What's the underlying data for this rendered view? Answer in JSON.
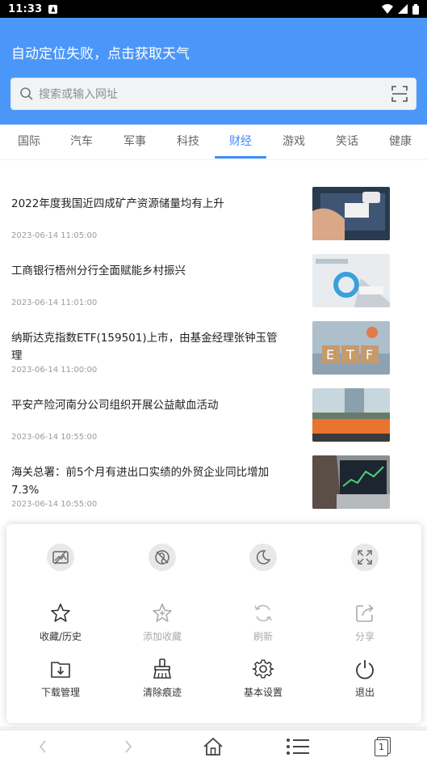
{
  "status_bar": {
    "time": "11:33"
  },
  "header": {
    "weather_text": "自动定位失败，点击获取天气",
    "search_placeholder": "搜索或输入网址",
    "accent": "#4b97f9"
  },
  "tabs": [
    {
      "label": "国际"
    },
    {
      "label": "汽车"
    },
    {
      "label": "军事"
    },
    {
      "label": "科技"
    },
    {
      "label": "财经",
      "active": true
    },
    {
      "label": "游戏"
    },
    {
      "label": "笑话"
    },
    {
      "label": "健康"
    }
  ],
  "news": [
    {
      "title": "2022年度我国近四成矿产资源储量均有上升",
      "time": "2023-06-14 11:05:00"
    },
    {
      "title": "工商银行梧州分行全面赋能乡村振兴",
      "time": "2023-06-14 11:01:00"
    },
    {
      "title": "纳斯达克指数ETF(159501)上市，由基金经理张钟玉管理",
      "time": "2023-06-14 11:00:00"
    },
    {
      "title": "平安产险河南分公司组织开展公益献血活动",
      "time": "2023-06-14 10:55:00"
    },
    {
      "title": "海关总署：前5个月有进出口实绩的外贸企业同比增加7.3%",
      "time": "2023-06-14 10:55:00"
    }
  ],
  "menu": {
    "quick_icons": [
      "no-image-icon",
      "no-trace-icon",
      "night-mode-icon",
      "fullscreen-icon"
    ],
    "row1": [
      {
        "label": "收藏/历史",
        "icon": "star-icon",
        "enabled": true
      },
      {
        "label": "添加收藏",
        "icon": "star-icon",
        "enabled": false
      },
      {
        "label": "刷新",
        "icon": "refresh-icon",
        "enabled": false
      },
      {
        "label": "分享",
        "icon": "share-icon",
        "enabled": false
      }
    ],
    "row2": [
      {
        "label": "下载管理",
        "icon": "download-folder-icon",
        "enabled": true
      },
      {
        "label": "清除痕迹",
        "icon": "broom-icon",
        "enabled": true
      },
      {
        "label": "基本设置",
        "icon": "gear-icon",
        "enabled": true
      },
      {
        "label": "退出",
        "icon": "power-icon",
        "enabled": true
      }
    ]
  },
  "bottom_bar": {
    "tab_count": "1"
  }
}
